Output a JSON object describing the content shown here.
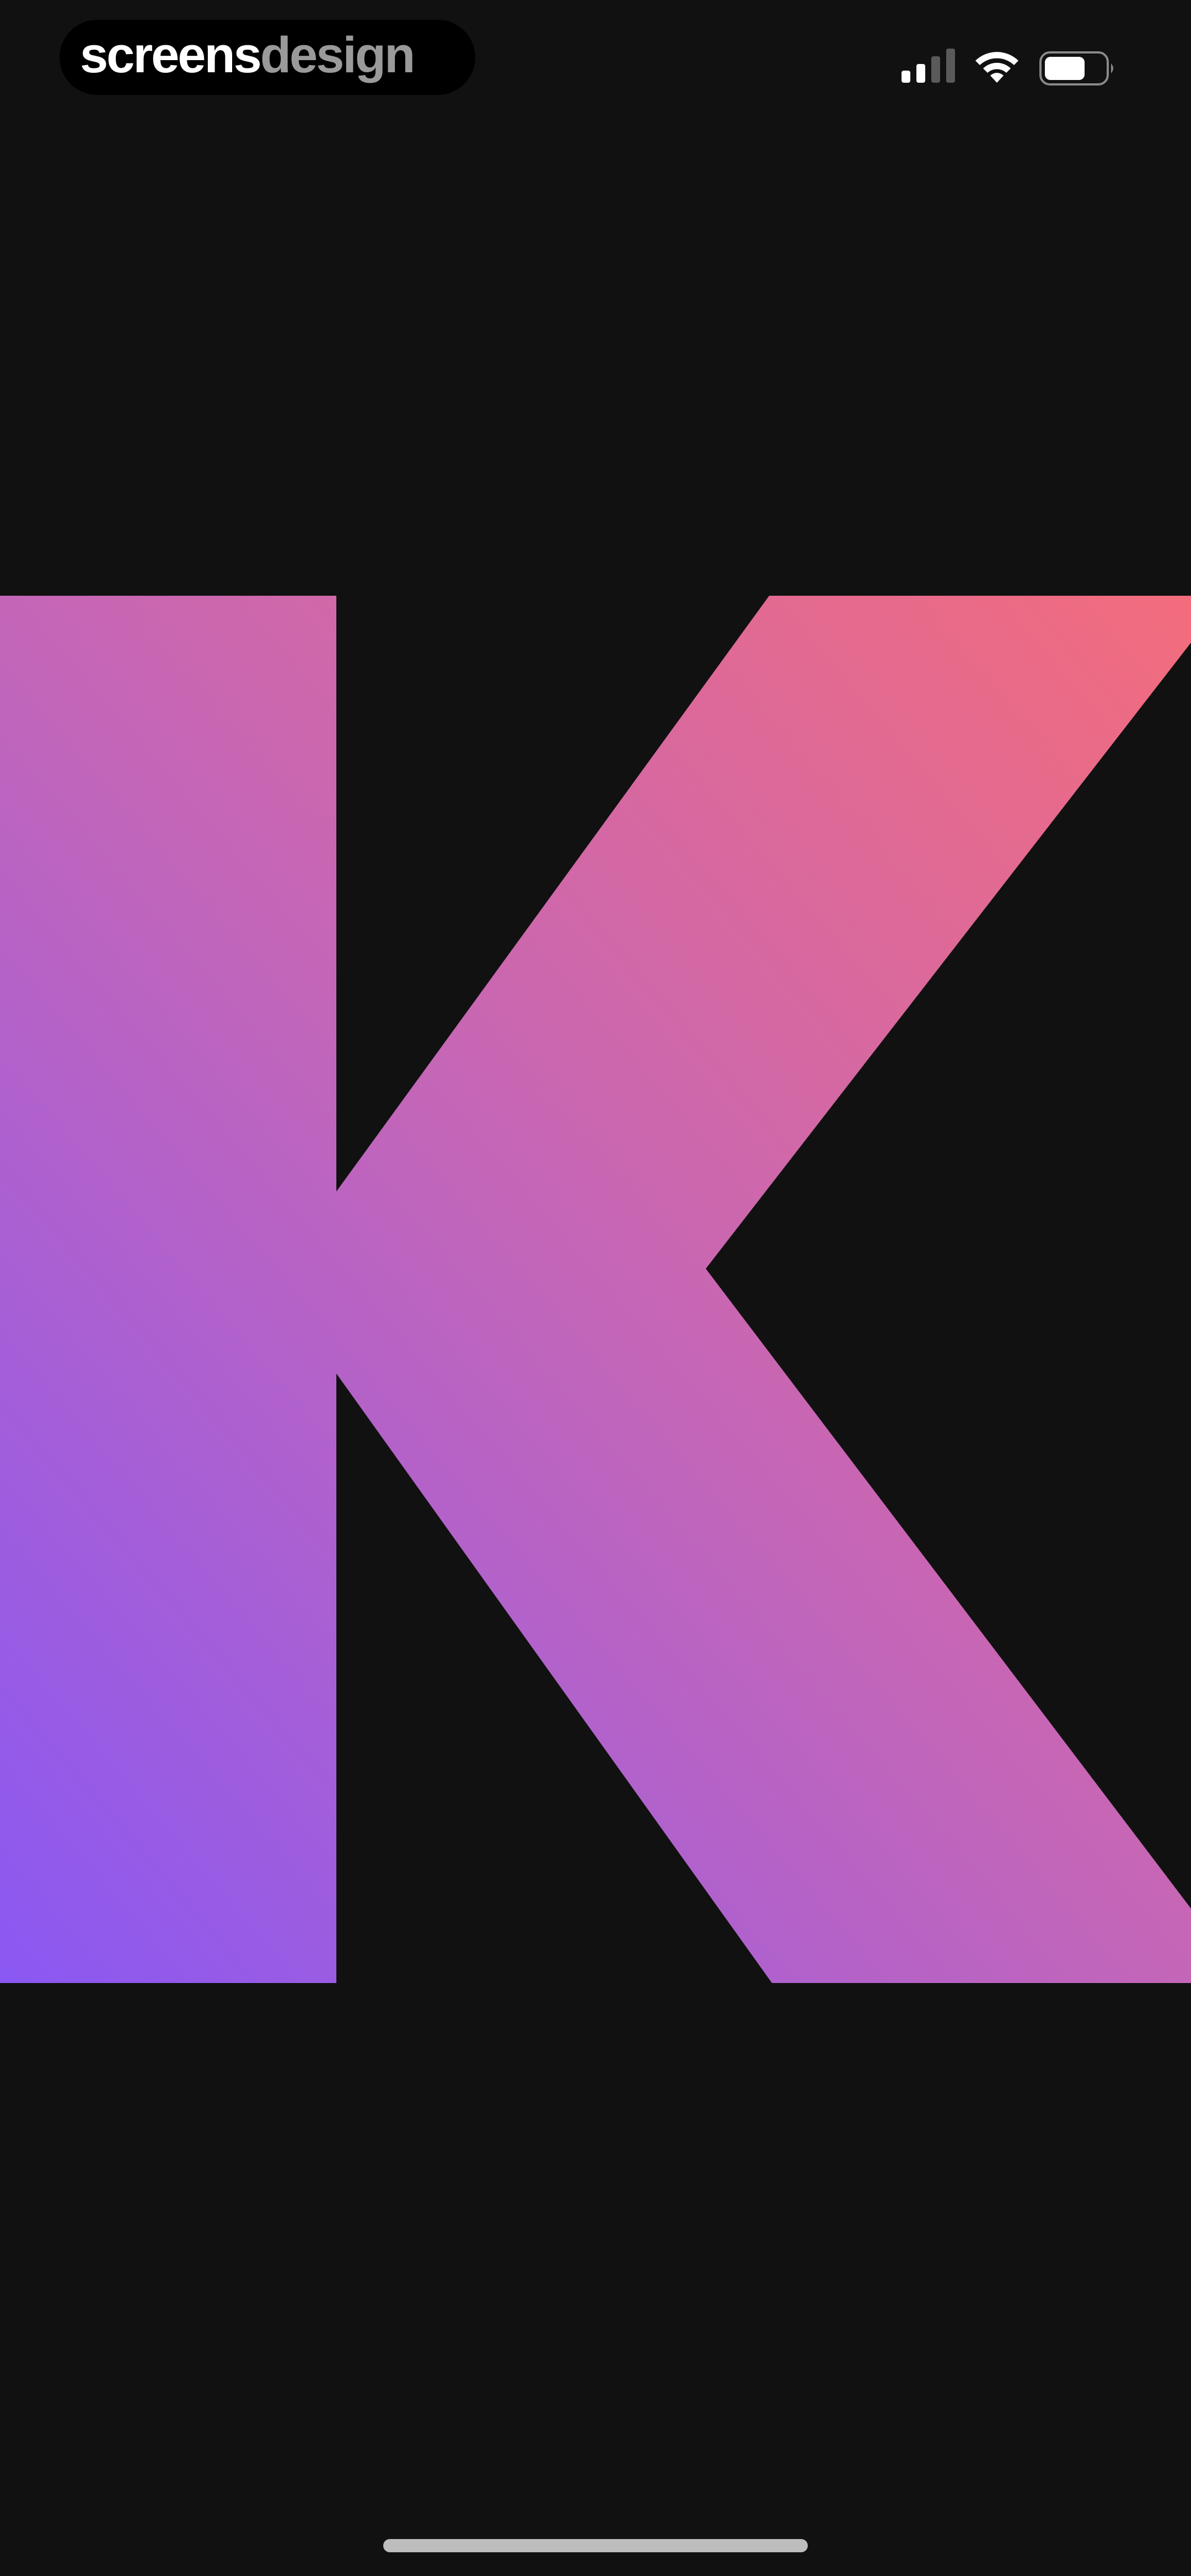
{
  "watermark": {
    "part1": "screens",
    "part2": "design",
    "part1_color": "#ffffff",
    "part2_color": "#9a9a9a"
  },
  "status_bar": {
    "signal_icon": "cellular-signal-icon",
    "wifi_icon": "wifi-icon",
    "battery_icon": "battery-icon"
  },
  "hero": {
    "letter": "K",
    "gradient_start": "#8a58f3",
    "gradient_end": "#f36c7c",
    "background": "#111111"
  },
  "home_indicator": {
    "color": "#bdbdbd"
  }
}
